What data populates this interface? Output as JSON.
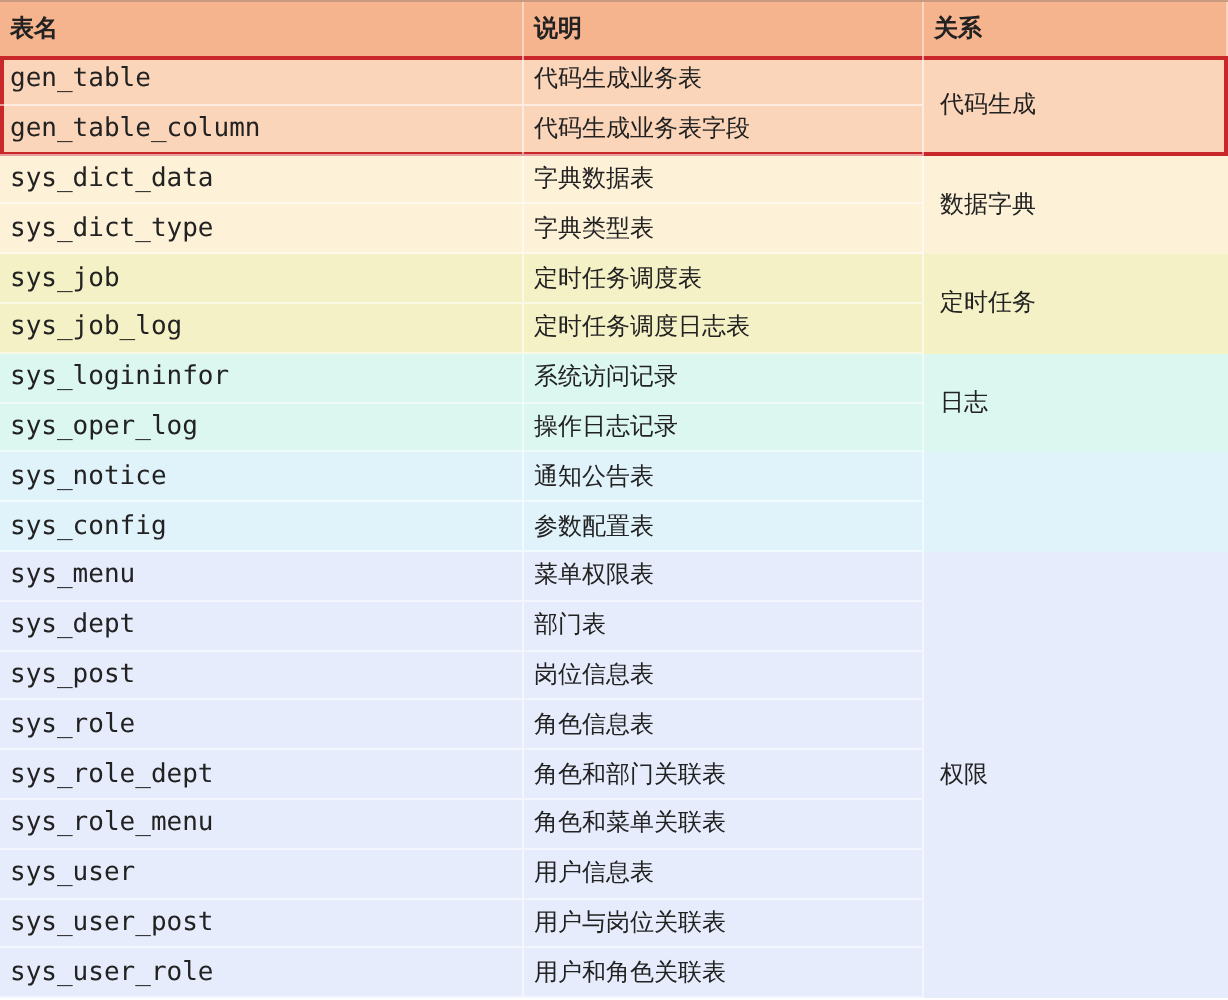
{
  "header": [
    "表名",
    "说明",
    "关系"
  ],
  "groups": [
    {
      "relation": "代码生成",
      "color": "#fbd5b9",
      "highlighted": true,
      "rows": [
        {
          "name": "gen_table",
          "desc": "代码生成业务表"
        },
        {
          "name": "gen_table_column",
          "desc": "代码生成业务表字段"
        }
      ]
    },
    {
      "relation": "数据字典",
      "color": "#fdf1d8",
      "highlighted": false,
      "rows": [
        {
          "name": "sys_dict_data",
          "desc": "字典数据表"
        },
        {
          "name": "sys_dict_type",
          "desc": "字典类型表"
        }
      ]
    },
    {
      "relation": "定时任务",
      "color": "#f4f1c6",
      "highlighted": false,
      "rows": [
        {
          "name": "sys_job",
          "desc": "定时任务调度表"
        },
        {
          "name": "sys_job_log",
          "desc": "定时任务调度日志表"
        }
      ]
    },
    {
      "relation": "日志",
      "color": "#dbf7f0",
      "highlighted": false,
      "rows": [
        {
          "name": "sys_logininfor",
          "desc": "系统访问记录"
        },
        {
          "name": "sys_oper_log",
          "desc": "操作日志记录"
        }
      ]
    },
    {
      "color": "#e0f3fb",
      "highlighted": false,
      "rows": [
        {
          "name": "sys_notice",
          "desc": "通知公告表"
        },
        {
          "name": "sys_config",
          "desc": "参数配置表"
        }
      ]
    },
    {
      "relation": "权限",
      "color": "#e6ecfb",
      "highlighted": false,
      "rows": [
        {
          "name": "sys_menu",
          "desc": "菜单权限表"
        },
        {
          "name": "sys_dept",
          "desc": "部门表"
        },
        {
          "name": "sys_post",
          "desc": "岗位信息表"
        },
        {
          "name": "sys_role",
          "desc": "角色信息表"
        },
        {
          "name": "sys_role_dept",
          "desc": "角色和部门关联表"
        },
        {
          "name": "sys_role_menu",
          "desc": "角色和菜单关联表"
        },
        {
          "name": "sys_user",
          "desc": "用户信息表"
        },
        {
          "name": "sys_user_post",
          "desc": "用户与岗位关联表"
        },
        {
          "name": "sys_user_role",
          "desc": "用户和角色关联表"
        }
      ]
    }
  ]
}
